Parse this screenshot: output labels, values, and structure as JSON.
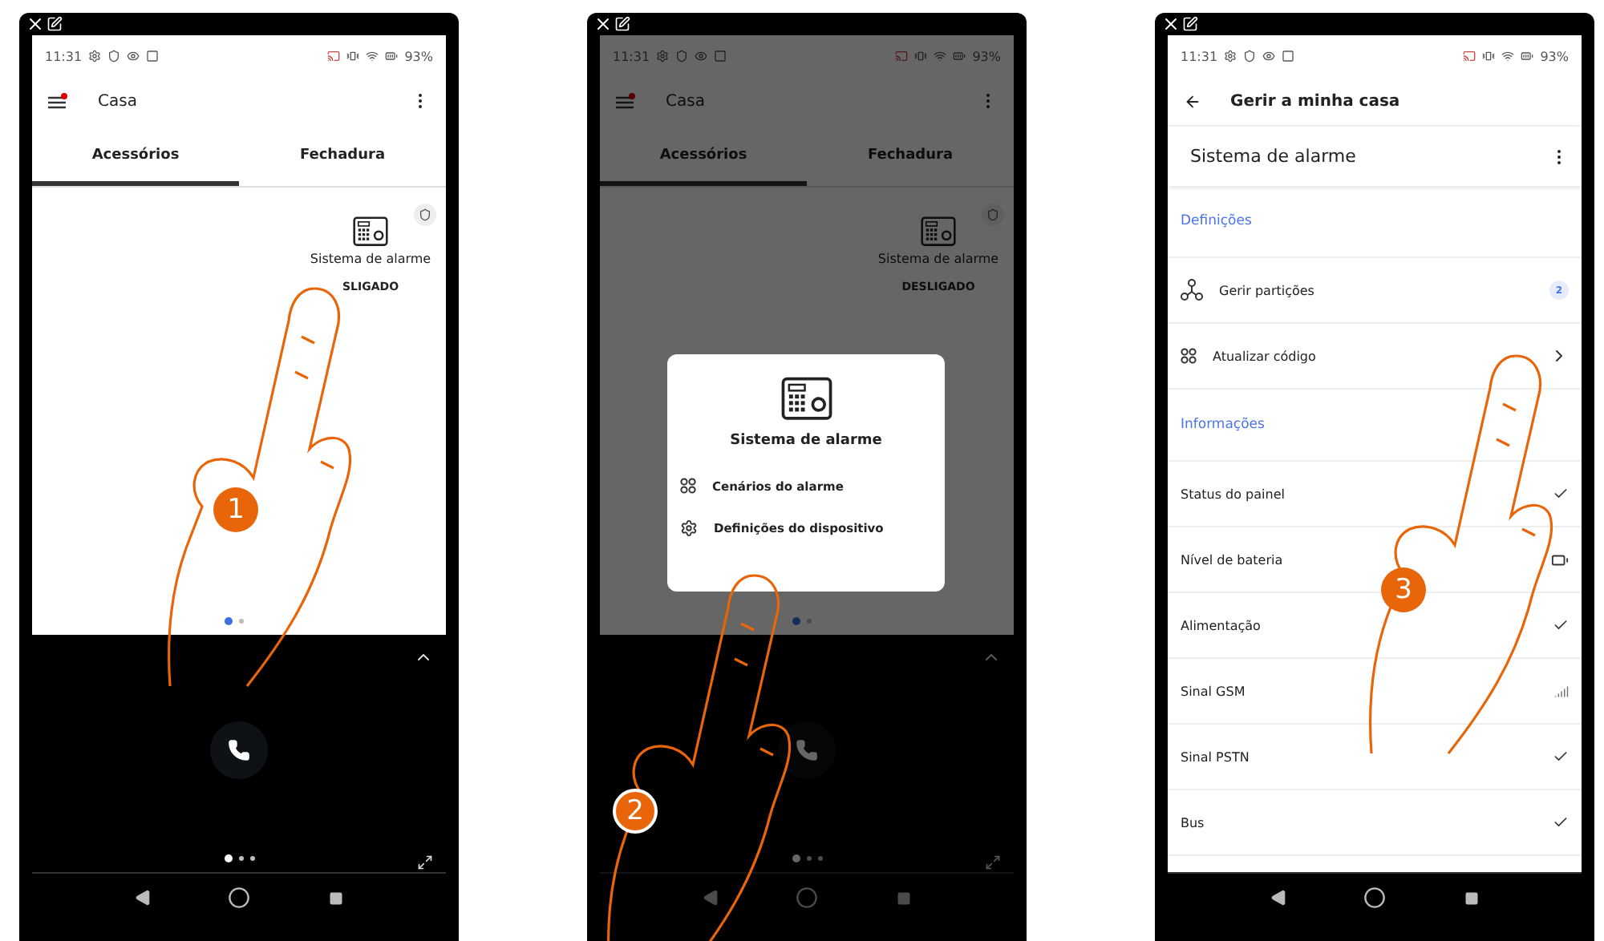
{
  "phones": [
    {
      "kind": "home",
      "dimmed": false,
      "status": {
        "time": "11:31",
        "battery": "93%"
      },
      "app_bar": {
        "title": "Casa"
      },
      "tabs": [
        {
          "label": "Acessórios",
          "selected": true
        },
        {
          "label": "Fechadura",
          "selected": false
        }
      ],
      "device": {
        "name": "Sistema de alarme",
        "state": "SLIGADO"
      },
      "pager": [
        {
          "selected": true
        },
        {
          "selected": false
        }
      ],
      "panel_pager": [
        {
          "selected": true
        },
        {
          "selected": false
        },
        {
          "selected": false
        }
      ],
      "step": "1"
    },
    {
      "kind": "home",
      "dimmed": true,
      "status": {
        "time": "11:31",
        "battery": "93%"
      },
      "app_bar": {
        "title": "Casa"
      },
      "tabs": [
        {
          "label": "Acessórios",
          "selected": true
        },
        {
          "label": "Fechadura",
          "selected": false
        }
      ],
      "device": {
        "name": "Sistema de alarme",
        "state": "DESLIGADO"
      },
      "pager": [
        {
          "selected": true
        },
        {
          "selected": false
        }
      ],
      "panel_pager": [
        {
          "selected": true
        },
        {
          "selected": false
        },
        {
          "selected": false
        }
      ],
      "popup": {
        "title": "Sistema de alarme",
        "items": [
          {
            "label": "Cenários do alarme"
          },
          {
            "label": "Definições do dispositivo"
          }
        ]
      },
      "step": "2"
    },
    {
      "kind": "settings",
      "status": {
        "time": "11:31",
        "battery": "93%"
      },
      "app_bar": {
        "title": "Gerir a minha casa"
      },
      "header": "Sistema de alarme",
      "sections": [
        {
          "title": "Definições",
          "items": [
            {
              "label": "Gerir partições",
              "kind": "count",
              "value": "2"
            },
            {
              "label": "Atualizar código",
              "kind": "chevron"
            }
          ]
        },
        {
          "title": "Informações",
          "items": [
            {
              "label": "Status do painel",
              "kind": "check"
            },
            {
              "label": "Nível de bateria",
              "kind": "battery"
            },
            {
              "label": "Alimentação",
              "kind": "check"
            },
            {
              "label": "Sinal GSM",
              "kind": "signal"
            },
            {
              "label": "Sinal PSTN",
              "kind": "check"
            },
            {
              "label": "Bus",
              "kind": "check"
            }
          ]
        }
      ],
      "step": "3"
    }
  ]
}
